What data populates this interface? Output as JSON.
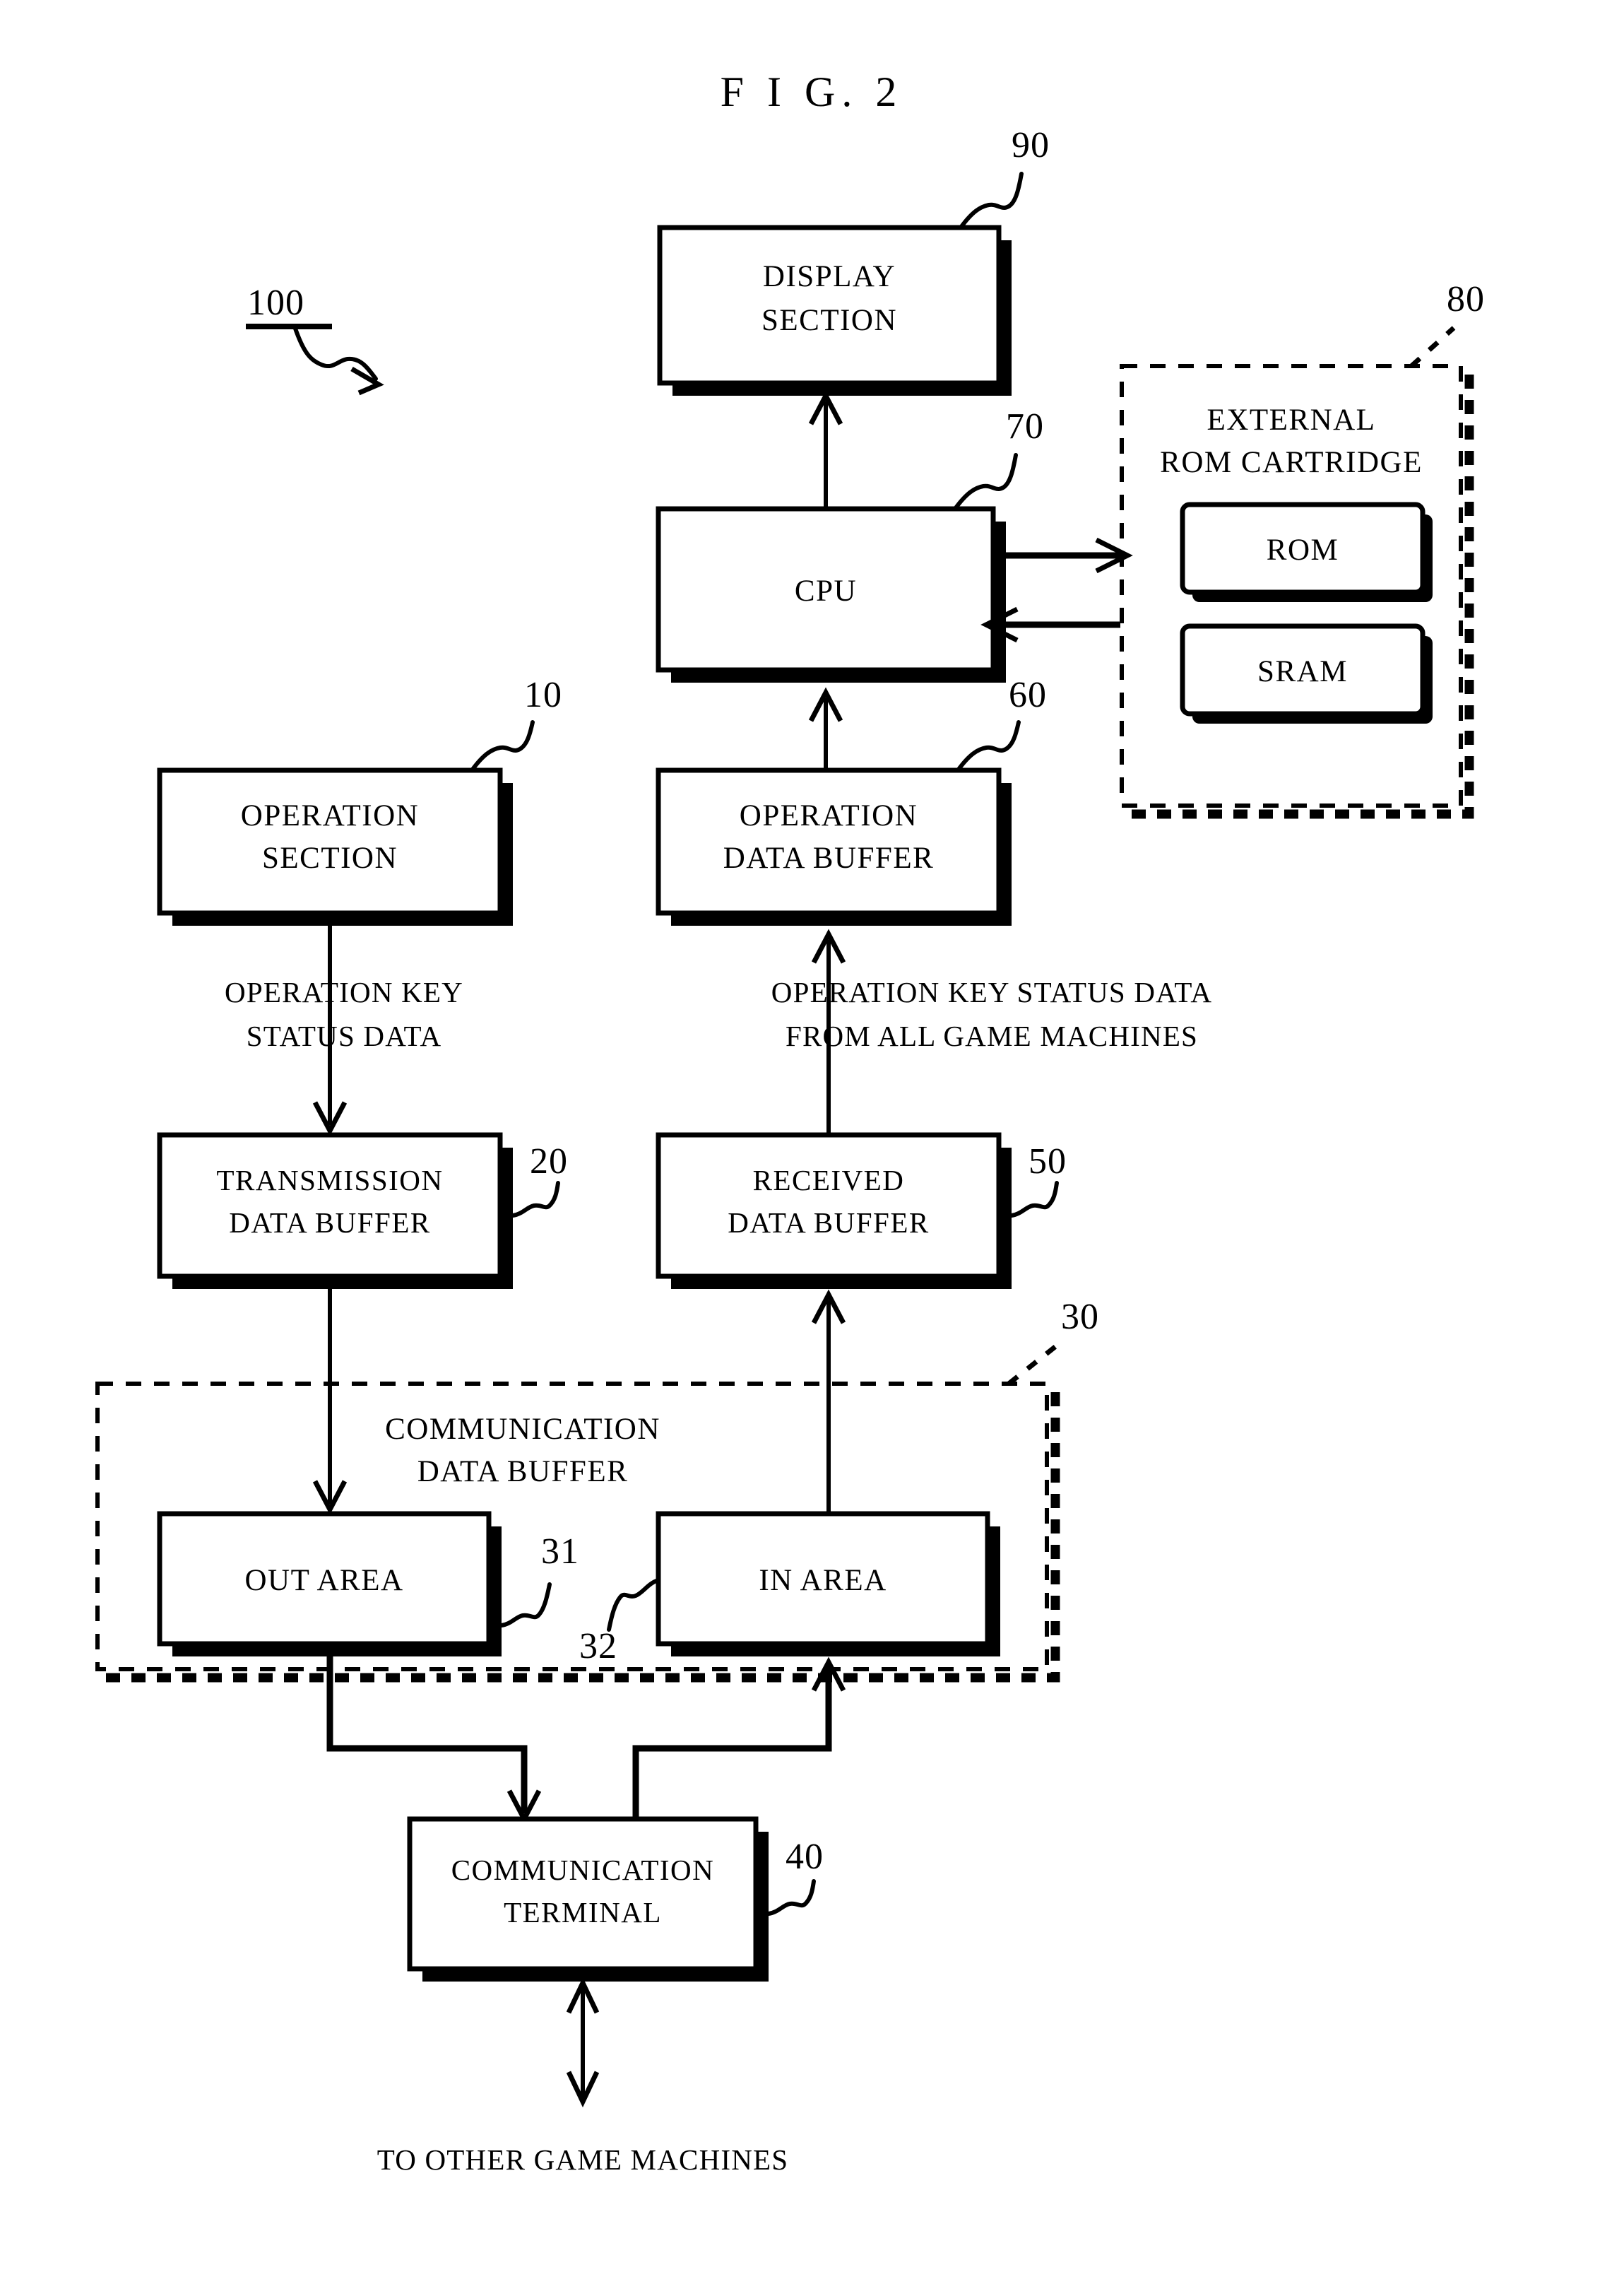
{
  "figure": {
    "title": "F I G.  2",
    "system_ref": "100",
    "caption_bottom": "TO OTHER GAME MACHINES"
  },
  "boxes": {
    "display_section": {
      "label_line1": "DISPLAY",
      "label_line2": "SECTION",
      "ref": "90"
    },
    "cpu": {
      "label": "CPU",
      "ref": "70"
    },
    "operation_section": {
      "label_line1": "OPERATION",
      "label_line2": "SECTION",
      "ref": "10"
    },
    "operation_data_buffer": {
      "label_line1": "OPERATION",
      "label_line2": "DATA BUFFER",
      "ref": "60"
    },
    "transmission_data_buffer": {
      "label_line1": "TRANSMISSION",
      "label_line2": "DATA BUFFER",
      "ref": "20"
    },
    "received_data_buffer": {
      "label_line1": "RECEIVED",
      "label_line2": "DATA BUFFER",
      "ref": "50"
    },
    "out_area": {
      "label": "OUT AREA",
      "ref": "31"
    },
    "in_area": {
      "label": "IN AREA",
      "ref": "32"
    },
    "communication_terminal": {
      "label_line1": "COMMUNICATION",
      "label_line2": "TERMINAL",
      "ref": "40"
    },
    "rom": {
      "label": "ROM"
    },
    "sram": {
      "label": "SRAM"
    }
  },
  "groups": {
    "external_rom_cartridge": {
      "label_line1": "EXTERNAL",
      "label_line2": "ROM CARTRIDGE",
      "ref": "80"
    },
    "communication_data_buffer": {
      "label_line1": "COMMUNICATION",
      "label_line2": "DATA BUFFER",
      "ref": "30"
    }
  },
  "edge_labels": {
    "left_flow_line1": "OPERATION KEY",
    "left_flow_line2": "STATUS DATA",
    "right_flow_line1": "OPERATION KEY STATUS DATA",
    "right_flow_line2": "FROM ALL GAME MACHINES"
  },
  "colors": {
    "ink": "#000000",
    "paper": "#ffffff"
  }
}
